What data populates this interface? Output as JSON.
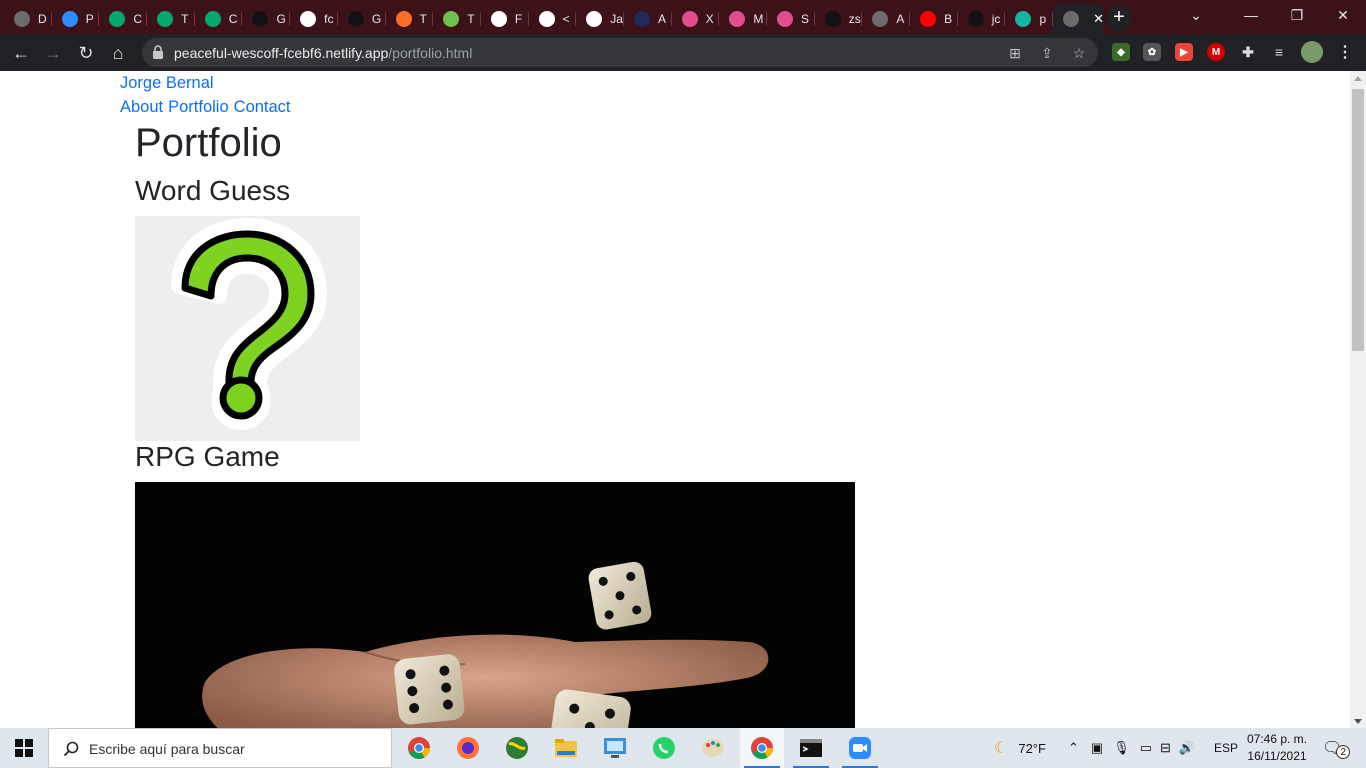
{
  "browser": {
    "tabs": [
      {
        "letter": "D",
        "icon": "globe-icon",
        "color": "#6b6b6b"
      },
      {
        "letter": "P",
        "icon": "zoom-icon",
        "color": "#2d8cff"
      },
      {
        "letter": "C",
        "icon": "w3-icon",
        "color": "#04aa6d"
      },
      {
        "letter": "T",
        "icon": "w3-icon",
        "color": "#04aa6d"
      },
      {
        "letter": "C",
        "icon": "w3-icon",
        "color": "#04aa6d"
      },
      {
        "letter": "G",
        "icon": "github-icon",
        "color": "#111111"
      },
      {
        "letter": "fc",
        "icon": "bird-icon",
        "color": "#ffffff"
      },
      {
        "letter": "G",
        "icon": "github-icon",
        "color": "#111111"
      },
      {
        "letter": "T",
        "icon": "gitlab-icon",
        "color": "#fc6d26"
      },
      {
        "letter": "T",
        "icon": "leaf-icon",
        "color": "#6cc24a"
      },
      {
        "letter": "F",
        "icon": "doc-icon",
        "color": "#ffffff"
      },
      {
        "letter": "<",
        "icon": "bird-icon",
        "color": "#ffffff"
      },
      {
        "letter": "Ja",
        "icon": "medium-icon",
        "color": "#ffffff"
      },
      {
        "letter": "A",
        "icon": "angular-icon",
        "color": "#1e2a5a"
      },
      {
        "letter": "X",
        "icon": "slides-icon",
        "color": "#e34c8e"
      },
      {
        "letter": "M",
        "icon": "slides-icon",
        "color": "#e34c8e"
      },
      {
        "letter": "S",
        "icon": "slides-icon",
        "color": "#e34c8e"
      },
      {
        "letter": "zs",
        "icon": "github-icon",
        "color": "#111111"
      },
      {
        "letter": "A",
        "icon": "globe-icon",
        "color": "#6b6b6b"
      },
      {
        "letter": "B",
        "icon": "youtube-icon",
        "color": "#ff0000"
      },
      {
        "letter": "jc",
        "icon": "github-icon",
        "color": "#111111"
      },
      {
        "letter": "p",
        "icon": "diamond-icon",
        "color": "#12b5a5"
      }
    ],
    "address": {
      "host": "peaceful-wescoff-fcebf6.netlify.app",
      "path": "/portfolio.html"
    }
  },
  "page": {
    "brand": "Jorge Bernal",
    "nav": [
      "About",
      "Portfolio",
      "Contact"
    ],
    "heading": "Portfolio",
    "projects": [
      {
        "title": "Word Guess"
      },
      {
        "title": "RPG Game"
      }
    ]
  },
  "taskbar": {
    "search_placeholder": "Escribe aquí para buscar",
    "weather": "72°F",
    "language": "ESP",
    "time": "07:46 p. m.",
    "date": "16/11/2021",
    "notifications": "2"
  }
}
